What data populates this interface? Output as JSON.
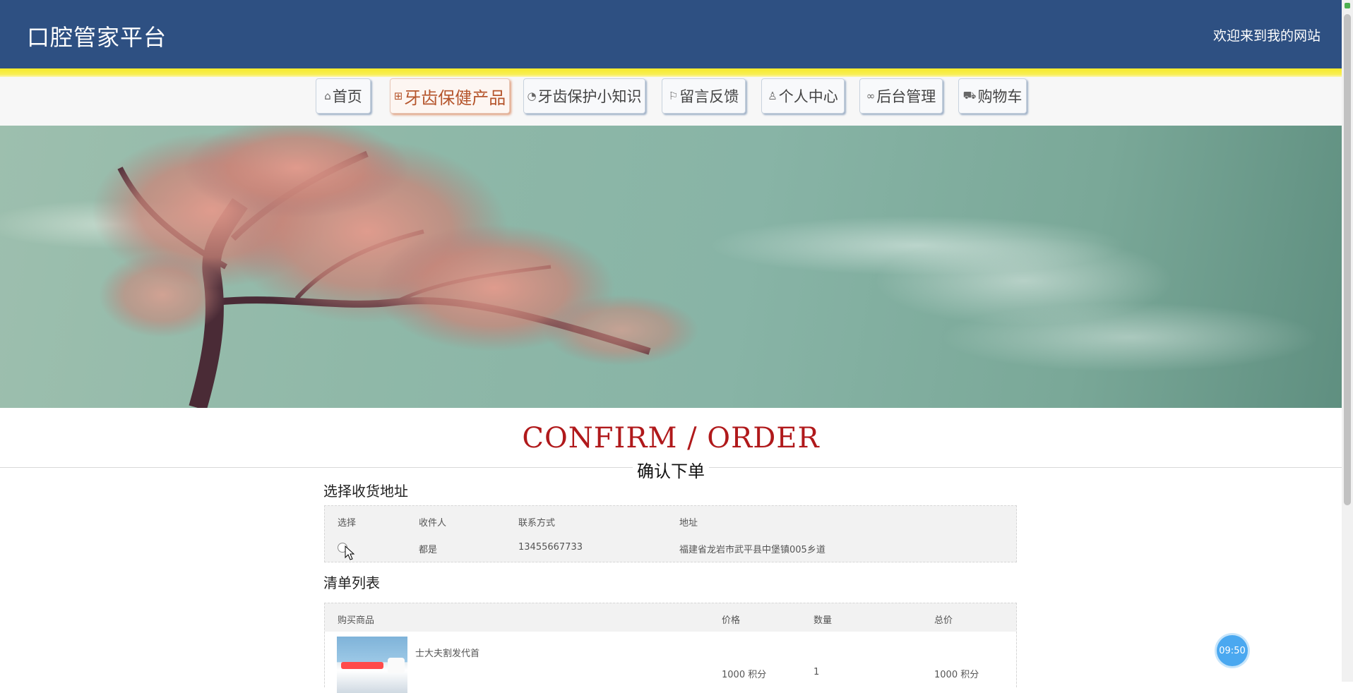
{
  "header": {
    "site_title": "口腔管家平台",
    "welcome": "欢迎来到我的网站"
  },
  "nav": {
    "items": [
      {
        "label": "首页",
        "icon": "home-icon",
        "glyph": "⌂"
      },
      {
        "label": "牙齿保健产品",
        "icon": "gift-icon",
        "glyph": "⊞"
      },
      {
        "label": "牙齿保护小知识",
        "icon": "palette-icon",
        "glyph": "◔"
      },
      {
        "label": "留言反馈",
        "icon": "flag-icon",
        "glyph": "⚐"
      },
      {
        "label": "个人中心",
        "icon": "user-icon",
        "glyph": "♙"
      },
      {
        "label": "后台管理",
        "icon": "link-icon",
        "glyph": "∞"
      },
      {
        "label": "购物车",
        "icon": "cart-icon",
        "glyph": "⛟"
      }
    ],
    "active_label": "牙齿保健产品"
  },
  "page": {
    "title": "CONFIRM / ORDER",
    "subtitle": "确认下单"
  },
  "address": {
    "heading": "选择收货地址",
    "columns": [
      "选择",
      "收件人",
      "联系方式",
      "地址"
    ],
    "rows": [
      {
        "recipient": "都是",
        "phone": "13455667733",
        "address": "福建省龙岩市武平县中堡镇005乡道"
      }
    ]
  },
  "order": {
    "heading": "清单列表",
    "columns": [
      "购买商品",
      "价格",
      "数量",
      "总价"
    ],
    "rows": [
      {
        "name": "士大夫割发代首",
        "price": "1000 积分",
        "quantity": "1",
        "total": "1000 积分"
      }
    ]
  },
  "timer": "09:50",
  "colors": {
    "header_bg": "#2e5082",
    "accent_yellow": "#f5ea2a",
    "title_red": "#b0191b",
    "active_nav": "#b5552c"
  }
}
